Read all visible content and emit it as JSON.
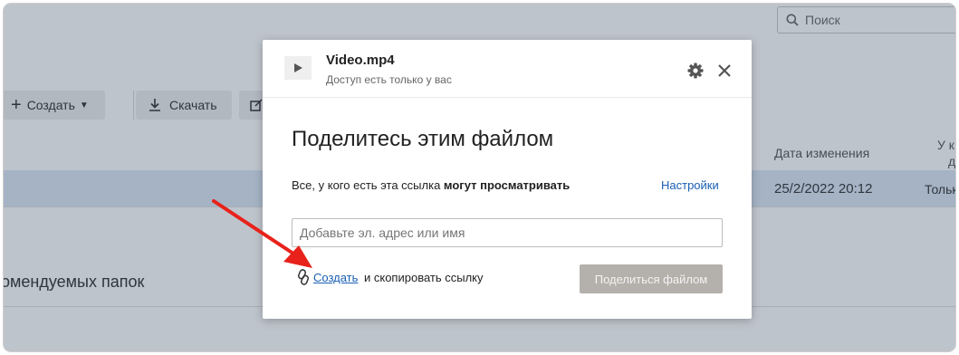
{
  "background": {
    "search_placeholder": "Поиск",
    "toolbar": {
      "create_label": "Создать",
      "download_label": "Скачать"
    },
    "columns": {
      "date_modified": "Дата изменения",
      "access_line1": "У к",
      "access_line2": "д"
    },
    "selected_row": {
      "date": "25/2/2022 20:12",
      "access": "Тольк"
    },
    "section_title": "омендуемых папок"
  },
  "dialog": {
    "file_name": "Video.mp4",
    "file_access": "Доступ есть только у вас",
    "title": "Поделитесь этим файлом",
    "permission_prefix": "Все, у кого есть эта ссылка",
    "permission_bold": "могут просматривать",
    "settings_link": "Настройки",
    "email_placeholder": "Добавьте эл. адрес или имя",
    "create_link": "Создать",
    "copy_text": "и скопировать ссылку",
    "share_button": "Поделиться файлом"
  },
  "colors": {
    "accent_link": "#1a5fb4",
    "arrow": "#e8221b",
    "share_button_disabled": "#b4b0ab"
  }
}
